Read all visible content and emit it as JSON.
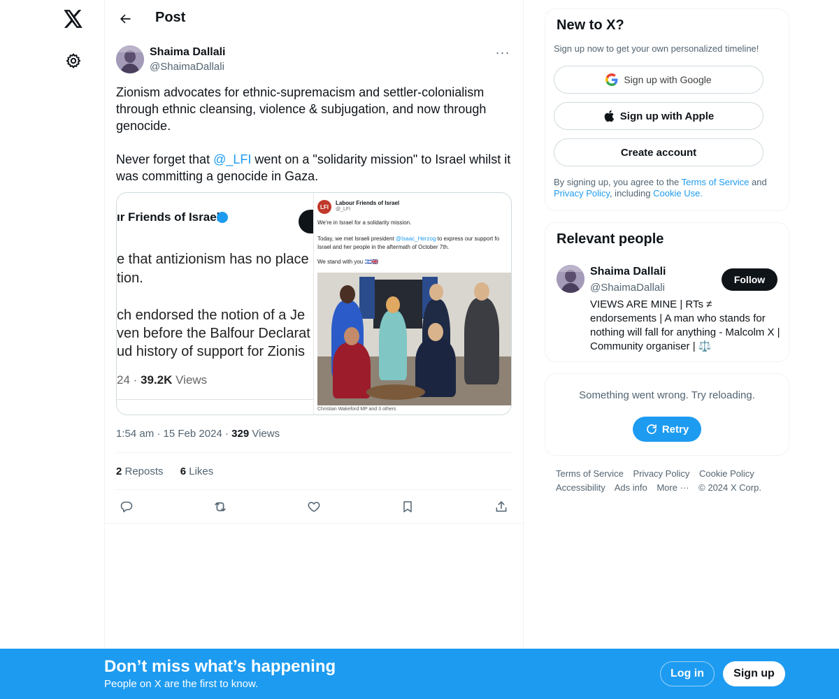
{
  "nav": {
    "logo_icon": "x-logo-icon",
    "settings_icon": "gear-icon"
  },
  "header": {
    "title": "Post",
    "back_icon": "arrow-left-icon"
  },
  "tweet": {
    "author_name": "Shaima Dallali",
    "author_handle": "@ShaimaDallali",
    "more_label": "···",
    "paragraph1": "Zionism advocates for ethnic-supremacism and settler-colonialism through ethnic cleansing, violence & subjugation, and now through genocide.",
    "paragraph2_before": "Never forget that ",
    "paragraph2_mention": "@_LFI",
    "paragraph2_after": " went on a \"solidarity mission\" to Israel whilst it was committing a genocide in Gaza.",
    "time": "1:54 am",
    "date": "15 Feb 2024",
    "views_count": "329",
    "views_label": " Views",
    "reposts_count": "2",
    "reposts_label": " Reposts",
    "likes_count": "6",
    "likes_label": " Likes"
  },
  "media": {
    "left": {
      "title": "ır Friends of Israel",
      "line1": "e that antizionism has no place",
      "line2": "tion.",
      "line3": "ch endorsed the notion of a Je",
      "line4": "ven before the Balfour Declarat",
      "line5": "ud history of support for Zionis",
      "views_prefix": "24 · ",
      "views_count": "39.2K",
      "views_label": " Views"
    },
    "right": {
      "logo": "LFI",
      "name": "Labour Friends of Israel",
      "handle": "@_LFI",
      "line1": "We're in Israel for a solidarity mission.",
      "line2_before": "Today, we met Israeli president ",
      "line2_link": "@Isaac_Herzog",
      "line2_after": " to express our support fo",
      "line3": "Israel and her people in the aftermath of October 7th.",
      "line4": "We stand with you 🇮🇱🇬🇧",
      "caption": "Christian Wakeford MP and 3 others"
    }
  },
  "signup_card": {
    "title": "New to X?",
    "subtitle": "Sign up now to get your own personalized timeline!",
    "google_label": "Sign up with Google",
    "apple_label": "Sign up with Apple",
    "create_label": "Create account",
    "terms_prefix": "By signing up, you agree to the ",
    "terms_link": "Terms of Service",
    "terms_and": " and ",
    "privacy_link": "Privacy Policy",
    "terms_including": ", including ",
    "cookie_link": "Cookie Use."
  },
  "relevant": {
    "title": "Relevant people",
    "name": "Shaima Dallali",
    "handle": "@ShaimaDallali",
    "follow_label": "Follow",
    "bio": "VIEWS ARE MINE | RTs ≠ endorsements | A man who stands for nothing will fall for anything - Malcolm X | Community organiser | ⚖️"
  },
  "error_card": {
    "message": "Something went wrong. Try reloading.",
    "retry_label": "Retry"
  },
  "footer": {
    "terms": "Terms of Service",
    "privacy": "Privacy Policy",
    "cookie": "Cookie Policy",
    "accessibility": "Accessibility",
    "ads": "Ads info",
    "more": "More ···",
    "copyright": "© 2024 X Corp."
  },
  "banner": {
    "title": "Don’t miss what’s happening",
    "subtitle": "People on X are the first to know.",
    "login_label": "Log in",
    "signup_label": "Sign up"
  },
  "colors": {
    "accent": "#1d9bf0",
    "text": "#0f1419",
    "muted": "#536471"
  }
}
